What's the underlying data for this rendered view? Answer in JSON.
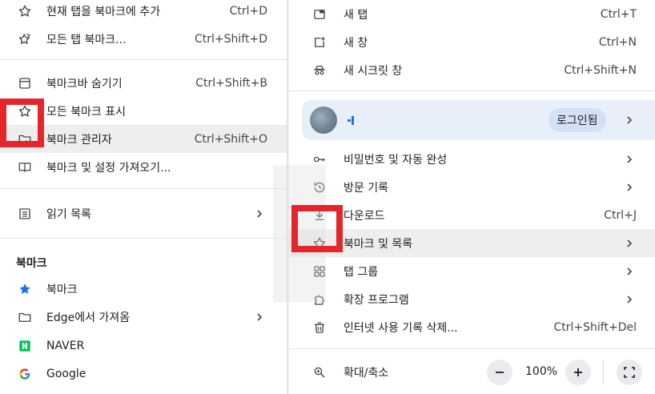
{
  "left_menu": {
    "items_top": [
      {
        "label": "현재 탭을 북마크에 추가",
        "shortcut": "Ctrl+D",
        "icon": "star-outline-icon"
      },
      {
        "label": "모든 탭 북마크...",
        "shortcut": "Ctrl+Shift+D",
        "icon": "star-multi-icon"
      }
    ],
    "items_mid": [
      {
        "label": "북마크바 숨기기",
        "shortcut": "Ctrl+Shift+B",
        "icon": "bookmark-bar-icon"
      },
      {
        "label": "모든 북마크 표시",
        "shortcut": "",
        "icon": "star-outline-icon"
      },
      {
        "label": "북마크 관리자",
        "shortcut": "Ctrl+Shift+O",
        "icon": "folder-manage-icon"
      },
      {
        "label": "북마크 및 설정 가져오기...",
        "shortcut": "",
        "icon": "import-book-icon"
      }
    ],
    "reading_list": {
      "label": "읽기 목록",
      "icon": "reading-list-icon"
    },
    "bookmarks_section": {
      "title": "북마크",
      "items": [
        {
          "label": "북마크",
          "icon": "star-filled-icon"
        },
        {
          "label": "Edge에서 가져옴",
          "icon": "folder-icon"
        },
        {
          "label": "NAVER",
          "icon": "naver-icon"
        },
        {
          "label": "Google",
          "icon": "google-icon"
        }
      ]
    }
  },
  "right_menu": {
    "items_top": [
      {
        "label": "새 탭",
        "shortcut": "Ctrl+T",
        "icon": "new-tab-icon"
      },
      {
        "label": "새 창",
        "shortcut": "Ctrl+N",
        "icon": "new-window-icon"
      },
      {
        "label": "새 시크릿 창",
        "shortcut": "Ctrl+Shift+N",
        "icon": "incognito-icon"
      }
    ],
    "profile": {
      "login_label": "로그인됨"
    },
    "items_mid": [
      {
        "label": "비밀번호 및 자동 완성",
        "shortcut": "",
        "icon": "key-icon",
        "submenu": true
      },
      {
        "label": "방문 기록",
        "shortcut": "",
        "icon": "history-icon",
        "submenu": true
      },
      {
        "label": "다운로드",
        "shortcut": "Ctrl+J",
        "icon": "download-icon",
        "submenu": false
      },
      {
        "label": "북마크 및 목록",
        "shortcut": "",
        "icon": "star-outline-icon",
        "submenu": true
      },
      {
        "label": "탭 그룹",
        "shortcut": "",
        "icon": "tab-groups-icon",
        "submenu": true
      },
      {
        "label": "확장 프로그램",
        "shortcut": "",
        "icon": "extension-icon",
        "submenu": true
      },
      {
        "label": "인터넷 사용 기록 삭제...",
        "shortcut": "Ctrl+Shift+Del",
        "icon": "trash-icon",
        "submenu": false
      }
    ],
    "zoom": {
      "label": "확대/축소",
      "value": "100%"
    }
  },
  "colors": {
    "highlight_box": "#e4262c",
    "accent_blue": "#1a73e8",
    "naver_green": "#03c75a"
  }
}
